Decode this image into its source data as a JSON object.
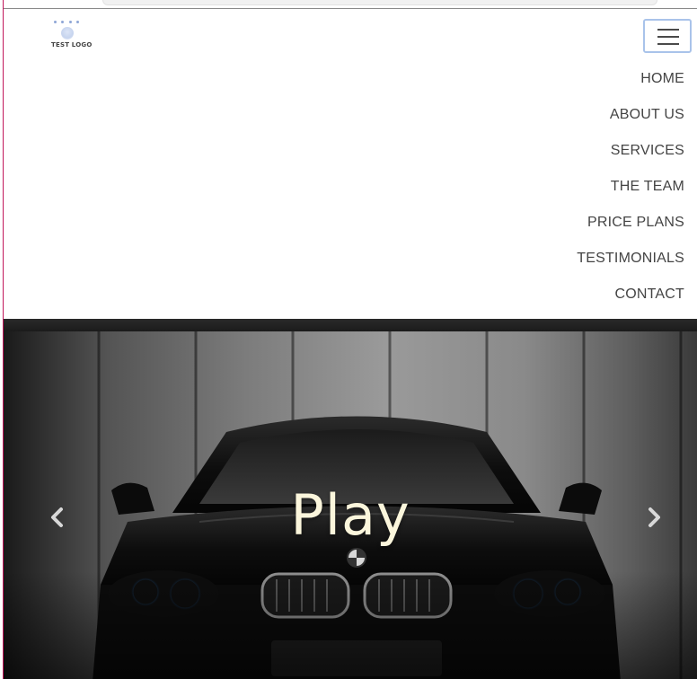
{
  "logo": {
    "text": "TEST LOGO"
  },
  "header": {
    "menu_toggle_icon": "hamburger-icon"
  },
  "nav": {
    "items": [
      {
        "label": "HOME"
      },
      {
        "label": "ABOUT US"
      },
      {
        "label": "SERVICES"
      },
      {
        "label": "THE TEAM"
      },
      {
        "label": "PRICE PLANS"
      },
      {
        "label": "TESTIMONIALS"
      },
      {
        "label": "CONTACT"
      }
    ]
  },
  "hero": {
    "caption": "Play",
    "prev_icon": "chevron-left-icon",
    "next_icon": "chevron-right-icon",
    "caption_color": "#fbf6dc"
  },
  "colors": {
    "nav_text": "#444444",
    "toggler_border": "#a9c3ea",
    "headlight_glow": "#4fb3ff"
  }
}
